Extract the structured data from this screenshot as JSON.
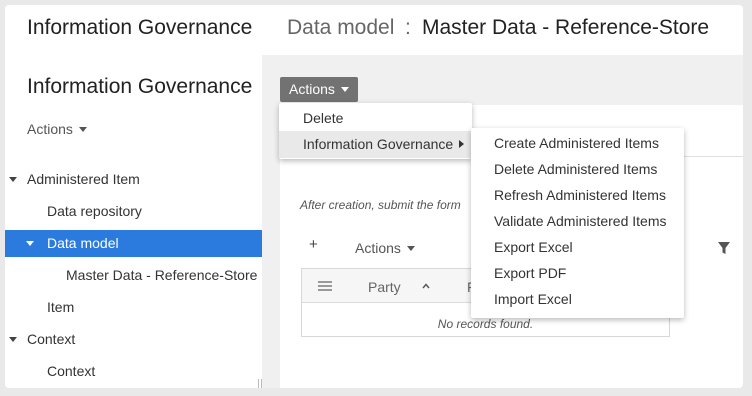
{
  "header": {
    "app_title": "Information Governance",
    "breadcrumb_model": "Data model",
    "breadcrumb_separator": ":",
    "breadcrumb_current": "Master Data - Reference-Store"
  },
  "sidebar": {
    "title": "Information Governance",
    "actions_label": "Actions",
    "tree": [
      {
        "label": "Administered Item",
        "level": 0,
        "expanded": true,
        "selected": false
      },
      {
        "label": "Data repository",
        "level": 1,
        "expanded": false,
        "selected": false
      },
      {
        "label": "Data model",
        "level": 1,
        "expanded": true,
        "selected": true
      },
      {
        "label": "Master Data - Reference-Store",
        "level": 2,
        "expanded": false,
        "selected": false
      },
      {
        "label": "Item",
        "level": 1,
        "expanded": false,
        "selected": false
      },
      {
        "label": "Context",
        "level": 0,
        "expanded": true,
        "selected": false
      },
      {
        "label": "Context",
        "level": 1,
        "expanded": false,
        "selected": false
      }
    ]
  },
  "main": {
    "actions_button": "Actions",
    "hint": "After creation, submit the form",
    "add_icon": "+",
    "grid_actions": "Actions",
    "grid": {
      "col_party": "Party",
      "col_f": "F",
      "empty_text": "No records found."
    }
  },
  "actions_menu": {
    "items": [
      {
        "label": "Delete",
        "has_submenu": false
      },
      {
        "label": "Information Governance",
        "has_submenu": true
      }
    ]
  },
  "submenu": {
    "items": [
      "Create Administered Items",
      "Delete Administered Items",
      "Refresh Administered Items",
      "Validate Administered Items",
      "Export Excel",
      "Export PDF",
      "Import Excel"
    ]
  },
  "colors": {
    "selected_bg": "#2b7bdf",
    "actions_button_bg": "#727272"
  }
}
